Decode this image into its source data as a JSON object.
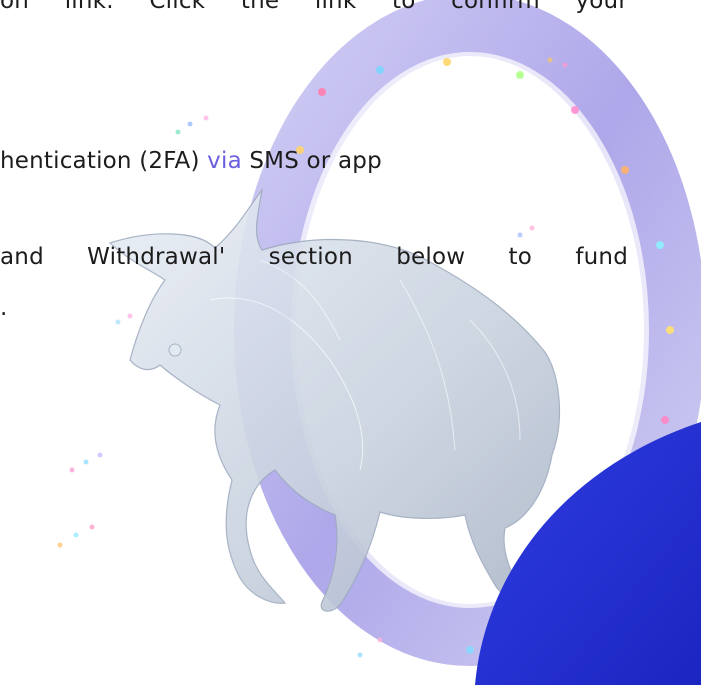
{
  "content": {
    "line_1": "on link. Click the link to confirm your",
    "line_2_before": "hentication (2FA) ",
    "line_2_highlight": "via",
    "line_2_after": " SMS or app",
    "line_3": "and Withdrawal' section below to fund",
    "line_4": "."
  },
  "colors": {
    "accent_blue": "#2430d8",
    "ring_purple": "#b7b3ee",
    "link_purple": "#6b5fe0"
  },
  "decor": {
    "illustration": "bull-icon",
    "ring": "ring-icon",
    "corner_shape": "blue-corner-shape"
  }
}
